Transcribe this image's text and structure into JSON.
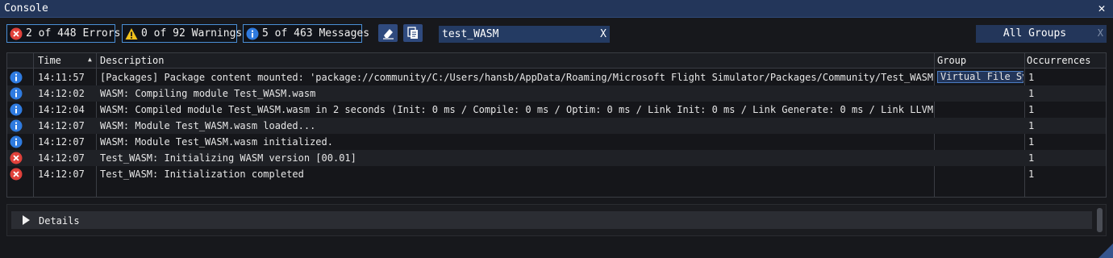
{
  "window": {
    "title": "Console",
    "close_glyph": "✕"
  },
  "filters": {
    "errors": {
      "label": "2 of 448 Errors",
      "icon": "error-icon"
    },
    "warnings": {
      "label": "0 of 92 Warnings",
      "icon": "warning-icon"
    },
    "messages": {
      "label": "5 of 463 Messages",
      "icon": "info-icon"
    }
  },
  "toolbar": {
    "clear_icon": "eraser-icon",
    "copy_icon": "copy-icon"
  },
  "search": {
    "value": "test_WASM",
    "clear_label": "X"
  },
  "groups": {
    "label": "All Groups",
    "clear_label": "X"
  },
  "columns": {
    "time": "Time",
    "description": "Description",
    "group": "Group",
    "occurrences": "Occurrences"
  },
  "rows": [
    {
      "type": "info",
      "time": "14:11:57",
      "description": "[Packages] Package content mounted: 'package://community/C:/Users/hansb/AppData/Roaming/Microsoft Flight Simulator/Packages/Community/Test_WASM'",
      "group": "Virtual File System",
      "occurrences": "1"
    },
    {
      "type": "info",
      "time": "14:12:02",
      "description": "WASM: Compiling module Test_WASM.wasm",
      "group": "",
      "occurrences": "1"
    },
    {
      "type": "info",
      "time": "14:12:04",
      "description": "WASM: Compiled module Test_WASM.wasm in 2 seconds (Init: 0 ms / Compile: 0 ms / Optim: 0 ms / Link Init: 0 ms / Link Generate: 0 ms / Link LLVM:",
      "group": "",
      "occurrences": "1"
    },
    {
      "type": "info",
      "time": "14:12:07",
      "description": "WASM: Module Test_WASM.wasm loaded...",
      "group": "",
      "occurrences": "1"
    },
    {
      "type": "info",
      "time": "14:12:07",
      "description": "WASM: Module Test_WASM.wasm initialized.",
      "group": "",
      "occurrences": "1"
    },
    {
      "type": "error",
      "time": "14:12:07",
      "description": "Test_WASM: Initializing WASM version [00.01]",
      "group": "",
      "occurrences": "1"
    },
    {
      "type": "error",
      "time": "14:12:07",
      "description": "Test_WASM: Initialization completed",
      "group": "",
      "occurrences": "1"
    }
  ],
  "details": {
    "label": "Details",
    "icon": "expand-triangle-icon"
  },
  "colors": {
    "info": "#2f7be0",
    "error": "#e0413b",
    "warning": "#f2c21b",
    "accent": "#23365a"
  }
}
